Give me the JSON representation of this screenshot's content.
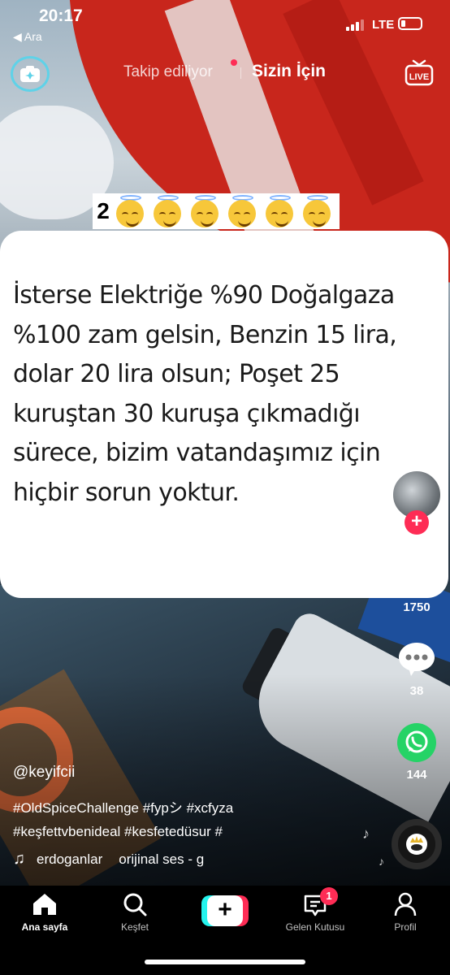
{
  "status_bar": {
    "time": "20:17",
    "back_label": "◀ Ara",
    "network": "LTE"
  },
  "top_nav": {
    "following_tab": "Takip ediliyor",
    "for_you_tab": "Sizin İçin",
    "live_label": "LIVE"
  },
  "video": {
    "emoji_prefix": "2",
    "card_text": "İsterse Elektriğe %90 Doğalgaza %100 zam gelsin, Benzin 15 lira, dolar 20 lira olsun; Poşet 25 kuruştan 30 kuruşa çıkmadığı sürece, bizim vatandaşımız için hiçbir sorun yoktur."
  },
  "side_actions": {
    "likes": "1750",
    "comments": "38",
    "shares": "144"
  },
  "post": {
    "author": "@keyifcii",
    "caption_line1": "#OldSpiceChallenge #fypシ #xcfyza",
    "caption_line2": "#keşfettvbenideal #kesfetedüsur #",
    "music_user": "erdoganlar",
    "music_title": "orijinal ses - g"
  },
  "bottom_nav": {
    "home": "Ana sayfa",
    "discover": "Keşfet",
    "inbox": "Gelen Kutusu",
    "inbox_badge": "1",
    "profile": "Profil"
  },
  "colors": {
    "accent": "#fe2c55",
    "cyan": "#25f4ee",
    "whatsapp": "#25d366"
  }
}
